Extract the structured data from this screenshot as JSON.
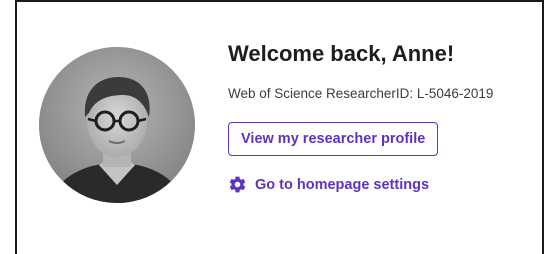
{
  "welcome": {
    "title": "Welcome back, Anne!",
    "researcher_id": "Web of Science ResearcherID: L-5046-2019",
    "profile_button_label": "View my researcher profile",
    "settings_link_label": "Go to homepage settings"
  },
  "colors": {
    "accent": "#5e33bf",
    "border": "#1a1a1a"
  },
  "icons": {
    "settings": "gear-icon",
    "avatar": "user-photo"
  }
}
